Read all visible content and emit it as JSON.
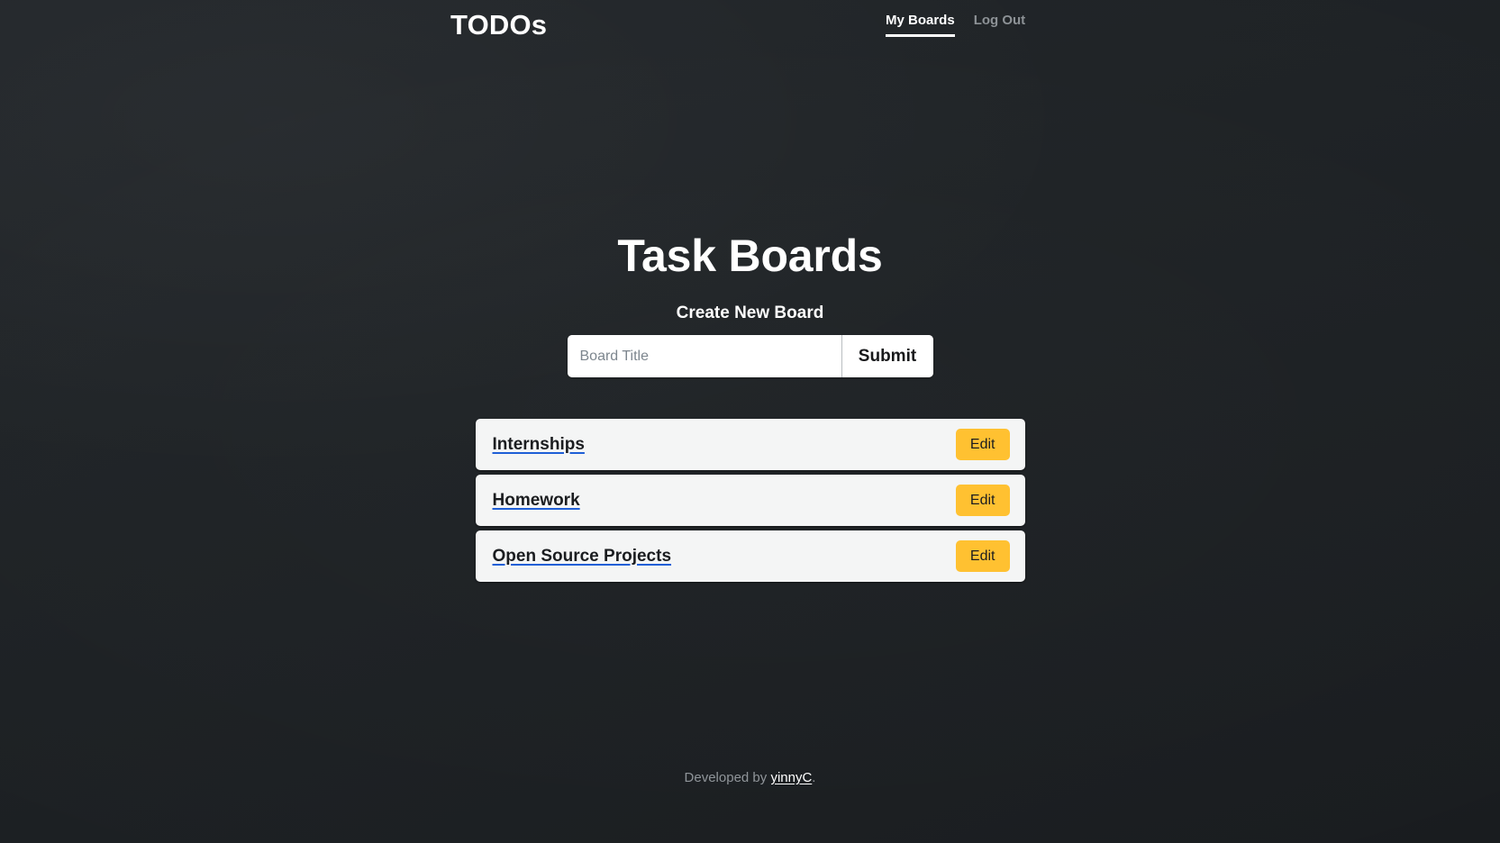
{
  "navbar": {
    "brand": "TODOs",
    "links": [
      {
        "label": "My Boards",
        "active": true
      },
      {
        "label": "Log Out",
        "active": false
      }
    ]
  },
  "main": {
    "page_title": "Task Boards",
    "create_section_title": "Create New Board",
    "form": {
      "input_placeholder": "Board Title",
      "input_value": "",
      "submit_label": "Submit"
    },
    "boards": [
      {
        "title": "Internships",
        "edit_label": "Edit"
      },
      {
        "title": "Homework",
        "edit_label": "Edit"
      },
      {
        "title": "Open Source Projects",
        "edit_label": "Edit"
      }
    ]
  },
  "footer": {
    "prefix": "Developed by ",
    "author": "yinnyC",
    "suffix": "."
  },
  "colors": {
    "page_background": "#1f2326",
    "card_background": "#f4f5f5",
    "accent_amber": "#ffc131",
    "link_underline_blue": "#1f5fd6",
    "muted_text": "#90959a"
  }
}
